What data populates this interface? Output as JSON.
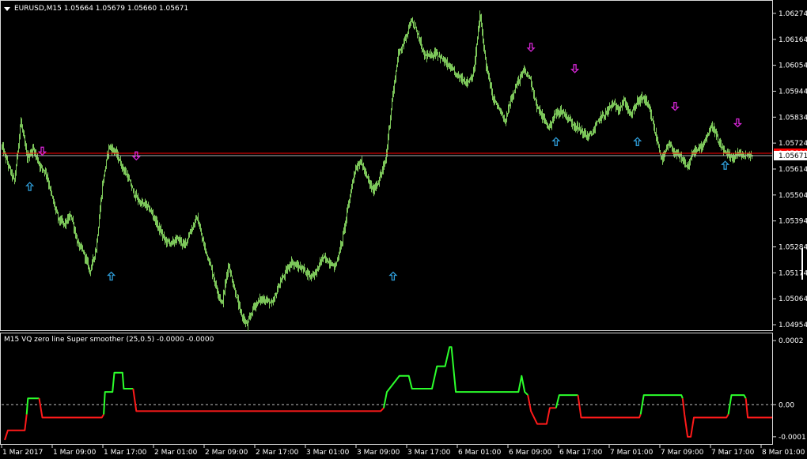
{
  "window": {
    "symbol_header": "EURUSD,M15  1.05664 1.05679 1.05660 1.05671"
  },
  "indicator": {
    "title": "M15 VQ zero line Super smoother (25,0.5) -0.0000 -0.0000"
  },
  "colors": {
    "background": "#000000",
    "bars": "#7cc65a",
    "up_arrow": "#2e9bd6",
    "down_arrow": "#d626d6",
    "ask_line": "#ff0000",
    "bid_line": "#b0b0b0",
    "osc_up": "#2cff2c",
    "osc_down": "#ff1a1a",
    "zero_line": "#bfbfbf",
    "axis_text": "#ffffff",
    "border": "#d8d8d8"
  },
  "price_axis": {
    "ticks": [
      "1.06274",
      "1.06164",
      "1.06054",
      "1.05944",
      "1.05834",
      "1.05724",
      "1.05614",
      "1.05504",
      "1.05394",
      "1.05284",
      "1.05174",
      "1.05064",
      "1.04954"
    ],
    "current_bid": "1.05671",
    "current_ask": "1.05681"
  },
  "indicator_axis": {
    "ticks": [
      "0.0002",
      "0.00",
      "-0.0001"
    ]
  },
  "time_axis": {
    "labels": [
      "1 Mar 2017",
      "1 Mar 09:00",
      "1 Mar 17:00",
      "2 Mar 01:00",
      "2 Mar 09:00",
      "2 Mar 17:00",
      "3 Mar 01:00",
      "3 Mar 09:00",
      "3 Mar 17:00",
      "6 Mar 01:00",
      "6 Mar 09:00",
      "6 Mar 17:00",
      "7 Mar 01:00",
      "7 Mar 09:00",
      "7 Mar 17:00",
      "8 Mar 01:00"
    ]
  },
  "chart_data": {
    "type": "bar",
    "symbol": "EURUSD",
    "timeframe": "M15",
    "ylim": [
      1.04934,
      1.06324
    ],
    "x_range": [
      "1 Mar 2017",
      "8 Mar 01:00"
    ],
    "close_path": [
      [
        0,
        1.0571
      ],
      [
        1,
        1.0563
      ],
      [
        2,
        1.0556
      ],
      [
        3,
        1.0582
      ],
      [
        4,
        1.0566
      ],
      [
        5,
        1.057
      ],
      [
        6,
        1.0563
      ],
      [
        7,
        1.056
      ],
      [
        8,
        1.0549
      ],
      [
        9,
        1.054
      ],
      [
        10,
        1.0538
      ],
      [
        11,
        1.0542
      ],
      [
        12,
        1.053
      ],
      [
        13,
        1.0526
      ],
      [
        14,
        1.0518
      ],
      [
        15,
        1.0528
      ],
      [
        16,
        1.0555
      ],
      [
        17,
        1.0571
      ],
      [
        18,
        1.0569
      ],
      [
        19,
        1.0563
      ],
      [
        20,
        1.0558
      ],
      [
        21,
        1.0551
      ],
      [
        22,
        1.0547
      ],
      [
        23,
        1.0546
      ],
      [
        24,
        1.0542
      ],
      [
        25,
        1.0536
      ],
      [
        26,
        1.0531
      ],
      [
        27,
        1.053
      ],
      [
        28,
        1.0532
      ],
      [
        29,
        1.0529
      ],
      [
        30,
        1.0535
      ],
      [
        31,
        1.0541
      ],
      [
        32,
        1.053
      ],
      [
        33,
        1.0522
      ],
      [
        34,
        1.0512
      ],
      [
        35,
        1.0504
      ],
      [
        36,
        1.0521
      ],
      [
        37,
        1.051
      ],
      [
        38,
        1.05
      ],
      [
        39,
        1.0495
      ],
      [
        40,
        1.0503
      ],
      [
        41,
        1.0506
      ],
      [
        42,
        1.0506
      ],
      [
        43,
        1.0504
      ],
      [
        44,
        1.0512
      ],
      [
        45,
        1.0517
      ],
      [
        46,
        1.0522
      ],
      [
        47,
        1.052
      ],
      [
        48,
        1.0519
      ],
      [
        49,
        1.0516
      ],
      [
        50,
        1.0518
      ],
      [
        51,
        1.0524
      ],
      [
        52,
        1.0522
      ],
      [
        53,
        1.052
      ],
      [
        54,
        1.053
      ],
      [
        55,
        1.0545
      ],
      [
        56,
        1.056
      ],
      [
        57,
        1.0565
      ],
      [
        58,
        1.0558
      ],
      [
        59,
        1.0552
      ],
      [
        60,
        1.0557
      ],
      [
        61,
        1.0565
      ],
      [
        62,
        1.059
      ],
      [
        63,
        1.061
      ],
      [
        64,
        1.0616
      ],
      [
        65,
        1.0624
      ],
      [
        66,
        1.062
      ],
      [
        67,
        1.061
      ],
      [
        68,
        1.0609
      ],
      [
        69,
        1.0611
      ],
      [
        70,
        1.0608
      ],
      [
        71,
        1.0605
      ],
      [
        72,
        1.0602
      ],
      [
        73,
        1.06
      ],
      [
        74,
        1.0598
      ],
      [
        75,
        1.0602
      ],
      [
        76,
        1.0627
      ],
      [
        77,
        1.0605
      ],
      [
        78,
        1.0592
      ],
      [
        79,
        1.0587
      ],
      [
        80,
        1.0581
      ],
      [
        81,
        1.0592
      ],
      [
        82,
        1.0598
      ],
      [
        83,
        1.0603
      ],
      [
        84,
        1.06
      ],
      [
        85,
        1.0588
      ],
      [
        86,
        1.0583
      ],
      [
        87,
        1.0579
      ],
      [
        88,
        1.0585
      ],
      [
        89,
        1.0586
      ],
      [
        90,
        1.0583
      ],
      [
        91,
        1.058
      ],
      [
        92,
        1.0578
      ],
      [
        93,
        1.0575
      ],
      [
        94,
        1.0577
      ],
      [
        95,
        1.0583
      ],
      [
        96,
        1.0585
      ],
      [
        97,
        1.0589
      ],
      [
        98,
        1.0587
      ],
      [
        99,
        1.059
      ],
      [
        100,
        1.0584
      ],
      [
        101,
        1.059
      ],
      [
        102,
        1.0592
      ],
      [
        103,
        1.0586
      ],
      [
        104,
        1.0575
      ],
      [
        105,
        1.0565
      ],
      [
        106,
        1.0572
      ],
      [
        107,
        1.0568
      ],
      [
        108,
        1.0566
      ],
      [
        109,
        1.0562
      ],
      [
        110,
        1.0569
      ],
      [
        111,
        1.057
      ],
      [
        112,
        1.0575
      ],
      [
        113,
        1.058
      ],
      [
        114,
        1.0572
      ],
      [
        115,
        1.0568
      ],
      [
        116,
        1.0566
      ],
      [
        117,
        1.0568
      ],
      [
        118,
        1.0567
      ],
      [
        119,
        1.0567
      ]
    ],
    "close_path_x_unit": "bar index",
    "current_bid": 1.05671,
    "current_ask": 1.05681,
    "up_arrows": [
      [
        4,
        1.0554
      ],
      [
        17,
        1.0516
      ],
      [
        62,
        1.0516
      ],
      [
        88,
        1.0573
      ],
      [
        101,
        1.0573
      ],
      [
        115,
        1.0563
      ]
    ],
    "down_arrows": [
      [
        6,
        1.0569
      ],
      [
        21,
        1.0567
      ],
      [
        84,
        1.0613
      ],
      [
        91,
        1.0604
      ],
      [
        107,
        1.0588
      ],
      [
        117,
        1.0581
      ]
    ],
    "arrow_x_unit": "bar index",
    "indicator": {
      "name": "VQ zero line Super smoother",
      "params": "25,0.5",
      "ylim": [
        -0.00012,
        0.00022
      ],
      "segments": [
        {
          "color": "down",
          "points": [
            [
              0,
              -0.00011
            ],
            [
              0.5,
              -8e-05
            ],
            [
              1.5,
              -8e-05
            ],
            [
              3.2,
              -8e-05
            ],
            [
              3.5,
              -3e-05
            ]
          ]
        },
        {
          "color": "up",
          "points": [
            [
              3.5,
              -3e-05
            ],
            [
              3.7,
              2e-05
            ],
            [
              5,
              2e-05
            ],
            [
              5.5,
              2e-05
            ]
          ]
        },
        {
          "color": "down",
          "points": [
            [
              5.5,
              2e-05
            ],
            [
              6,
              -4e-05
            ],
            [
              15.5,
              -4e-05
            ],
            [
              15.8,
              -3e-05
            ]
          ]
        },
        {
          "color": "up",
          "points": [
            [
              15.8,
              -3e-05
            ],
            [
              16,
              4e-05
            ],
            [
              17.2,
              4e-05
            ],
            [
              17.5,
              0.0001
            ],
            [
              18.8,
              0.0001
            ],
            [
              19,
              5e-05
            ],
            [
              20.5,
              5e-05
            ]
          ]
        },
        {
          "color": "down",
          "points": [
            [
              20.5,
              5e-05
            ],
            [
              21,
              -2e-05
            ],
            [
              56,
              -2e-05
            ],
            [
              60,
              -2e-05
            ],
            [
              60.5,
              -1e-05
            ]
          ]
        },
        {
          "color": "up",
          "points": [
            [
              60.5,
              -1e-05
            ],
            [
              61,
              4e-05
            ],
            [
              63,
              9e-05
            ],
            [
              64.5,
              9e-05
            ],
            [
              65,
              5e-05
            ],
            [
              68.2,
              5e-05
            ],
            [
              69,
              0.00012
            ],
            [
              70.3,
              0.00012
            ],
            [
              71,
              0.00018
            ],
            [
              71.3,
              0.00018
            ],
            [
              72,
              4e-05
            ],
            [
              80,
              4e-05
            ],
            [
              82,
              4e-05
            ],
            [
              82.5,
              9e-05
            ],
            [
              83,
              4e-05
            ],
            [
              83.5,
              3e-05
            ]
          ]
        },
        {
          "color": "down",
          "points": [
            [
              83.5,
              3e-05
            ],
            [
              84,
              -2e-05
            ],
            [
              85,
              -6e-05
            ],
            [
              86.5,
              -6e-05
            ],
            [
              87,
              -1e-05
            ],
            [
              88,
              -1e-05
            ]
          ]
        },
        {
          "color": "up",
          "points": [
            [
              88,
              -1e-05
            ],
            [
              88.5,
              3e-05
            ],
            [
              91,
              3e-05
            ],
            [
              91.5,
              3e-05
            ]
          ]
        },
        {
          "color": "down",
          "points": [
            [
              91.5,
              3e-05
            ],
            [
              92,
              -4e-05
            ],
            [
              101.3,
              -4e-05
            ],
            [
              101.5,
              -3e-05
            ]
          ]
        },
        {
          "color": "up",
          "points": [
            [
              101.5,
              -3e-05
            ],
            [
              102,
              3e-05
            ],
            [
              108,
              3e-05
            ],
            [
              108.2,
              2e-05
            ]
          ]
        },
        {
          "color": "down",
          "points": [
            [
              108.2,
              2e-05
            ],
            [
              108.5,
              -3e-05
            ],
            [
              109,
              -0.0001
            ],
            [
              109.5,
              -0.0001
            ],
            [
              110,
              -4e-05
            ],
            [
              115.2,
              -4e-05
            ],
            [
              115.5,
              -3e-05
            ]
          ]
        },
        {
          "color": "up",
          "points": [
            [
              115.5,
              -3e-05
            ],
            [
              116,
              3e-05
            ],
            [
              118,
              3e-05
            ],
            [
              118.3,
              2e-05
            ]
          ]
        },
        {
          "color": "down",
          "points": [
            [
              118.3,
              2e-05
            ],
            [
              118.6,
              -4e-05
            ],
            [
              122.5,
              -4e-05
            ]
          ]
        }
      ]
    }
  }
}
